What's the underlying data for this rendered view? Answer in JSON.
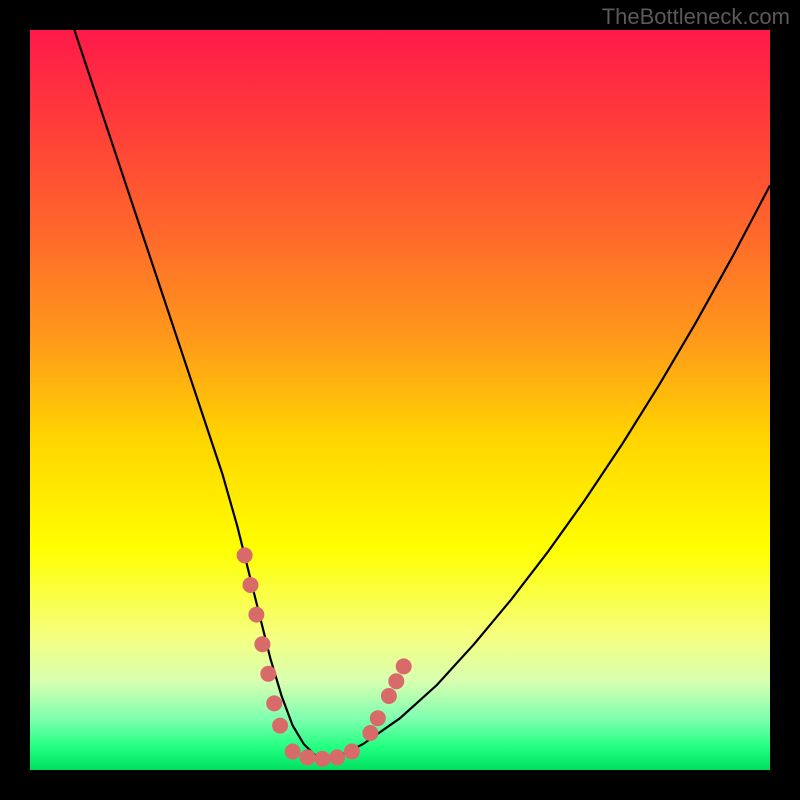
{
  "watermark": "TheBottleneck.com",
  "chart_data": {
    "type": "line",
    "title": "",
    "xlabel": "",
    "ylabel": "",
    "xlim": [
      0,
      100
    ],
    "ylim": [
      0,
      100
    ],
    "grid": false,
    "legend": false,
    "background_gradient": {
      "stops": [
        {
          "pos": 0.0,
          "color": "#ff1a4a"
        },
        {
          "pos": 0.12,
          "color": "#ff3a3a"
        },
        {
          "pos": 0.28,
          "color": "#ff6a2a"
        },
        {
          "pos": 0.42,
          "color": "#ff9a1a"
        },
        {
          "pos": 0.55,
          "color": "#ffd400"
        },
        {
          "pos": 0.7,
          "color": "#ffff00"
        },
        {
          "pos": 0.82,
          "color": "#f5ff80"
        },
        {
          "pos": 0.88,
          "color": "#d8ffb0"
        },
        {
          "pos": 0.93,
          "color": "#80ffb0"
        },
        {
          "pos": 0.97,
          "color": "#20ff80"
        },
        {
          "pos": 1.0,
          "color": "#00e060"
        }
      ]
    },
    "series": [
      {
        "name": "bottleneck-curve",
        "color": "#000000",
        "x": [
          6,
          8,
          10,
          12,
          14,
          16,
          18,
          20,
          22,
          24,
          26,
          28,
          29.5,
          31,
          32.5,
          34,
          35.5,
          37,
          38.5,
          40,
          42,
          45,
          50,
          55,
          60,
          65,
          70,
          75,
          80,
          85,
          90,
          95,
          100
        ],
        "y": [
          100,
          94,
          88,
          82,
          76,
          70,
          64,
          58,
          52,
          46,
          40,
          33,
          27,
          21,
          15,
          10,
          6,
          3.5,
          2,
          1.5,
          2,
          3.5,
          7,
          11.5,
          17,
          23,
          29.5,
          36.5,
          44,
          52,
          60.5,
          69.5,
          79
        ]
      }
    ],
    "markers": {
      "name": "highlight-dots",
      "color": "#d86a6a",
      "radius": 8,
      "points": [
        {
          "x": 29.0,
          "y": 29
        },
        {
          "x": 29.8,
          "y": 25
        },
        {
          "x": 30.6,
          "y": 21
        },
        {
          "x": 31.4,
          "y": 17
        },
        {
          "x": 32.2,
          "y": 13
        },
        {
          "x": 33.0,
          "y": 9
        },
        {
          "x": 33.8,
          "y": 6
        },
        {
          "x": 35.5,
          "y": 2.5
        },
        {
          "x": 37.5,
          "y": 1.7
        },
        {
          "x": 39.5,
          "y": 1.5
        },
        {
          "x": 41.5,
          "y": 1.7
        },
        {
          "x": 43.5,
          "y": 2.5
        },
        {
          "x": 46.0,
          "y": 5
        },
        {
          "x": 47.0,
          "y": 7
        },
        {
          "x": 48.5,
          "y": 10
        },
        {
          "x": 49.5,
          "y": 12
        },
        {
          "x": 50.5,
          "y": 14
        }
      ]
    }
  }
}
